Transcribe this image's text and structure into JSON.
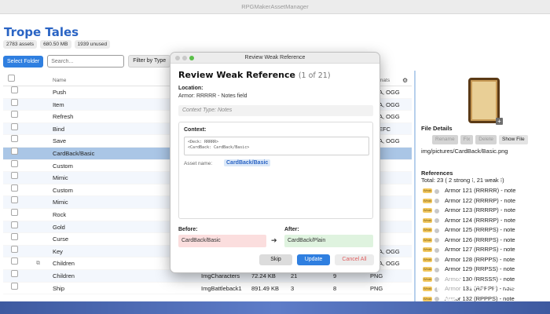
{
  "window": {
    "title": "RPGMakerAssetManager"
  },
  "app": {
    "title": "Trope Tales"
  },
  "stats": [
    "2783 assets",
    "680.50 MB",
    "1939 unused"
  ],
  "toolbar": {
    "select_folder": "Select Folder",
    "search_placeholder": "Search...",
    "filter": "Filter by Type"
  },
  "table": {
    "columns": {
      "name": "Name",
      "formats": "mats"
    },
    "rows": [
      {
        "name": "Push",
        "ext": "A, OGG"
      },
      {
        "name": "Item",
        "ext": "A, OGG"
      },
      {
        "name": "Refresh",
        "ext": "A, OGG"
      },
      {
        "name": "Bind",
        "ext": "EFC"
      },
      {
        "name": "Save",
        "ext": "A, OGG"
      },
      {
        "name": "CardBack/Basic",
        "ext": ""
      },
      {
        "name": "Custom",
        "ext": ""
      },
      {
        "name": "Mimic",
        "ext": ""
      },
      {
        "name": "Custom",
        "ext": ""
      },
      {
        "name": "Mimic",
        "ext": ""
      },
      {
        "name": "Rock",
        "ext": ""
      },
      {
        "name": "Gold",
        "ext": ""
      },
      {
        "name": "Curse",
        "ext": ""
      },
      {
        "name": "Key",
        "ext": "A, OGG"
      },
      {
        "name": "Children",
        "ext": "A, OGG"
      },
      {
        "name": "Children",
        "type": "ImgCharacters",
        "size": "72.24 KB",
        "n1": "21",
        "n2": "9",
        "fmt": "PNG"
      },
      {
        "name": "Ship",
        "type": "ImgBattleback1",
        "size": "891.49 KB",
        "n1": "3",
        "n2": "8",
        "fmt": "PNG"
      }
    ]
  },
  "panel": {
    "file_details": "File Details",
    "buttons": [
      "Rename",
      "Fix",
      "Delete",
      "Show File"
    ],
    "path": "img/pictures/CardBack/Basic.png",
    "references_title": "References",
    "total": "Total: 23 ( 2 strong ⁝, 21 weak ⁝)",
    "tag": "Weak",
    "refs": [
      "Armor 121 (RRRRR) - note",
      "Armor 122 (RRRRP) - note",
      "Armor 123 (RRRRP) - note",
      "Armor 124 (RRRRP) - note",
      "Armor 125 (RRRPS) - note",
      "Armor 126 (RRRPS) - note",
      "Armor 127 (RRRPS) - note",
      "Armor 128 (RRPPS) - note",
      "Armor 129 (RRPSS) - note",
      "Armor 130 (RRSSS) - note",
      "Armor 131 (RPPPP) - note",
      "Armor 132 (RPPPS) - note"
    ]
  },
  "dialog": {
    "window_title": "Review Weak Reference",
    "heading": "Review Weak Reference",
    "counter": "(1 of 21)",
    "location_label": "Location:",
    "location_value": "Armor: RRRRR - Notes field",
    "context_type": "Context Type: Notes",
    "context_label": "Context:",
    "code_line1": "<Deck: RRRRR>",
    "code_line2": "<CardBack: CardBack/Basic>",
    "asset_label": "Asset name:",
    "asset_value": "CardBack/Basic",
    "before_label": "Before:",
    "before_value": "CardBack/Basic",
    "after_label": "After:",
    "after_value": "CardBack/Plain",
    "skip": "Skip",
    "update": "Update",
    "cancel_all": "Cancel All"
  },
  "watermark": "Get Into Pc",
  "colors": {
    "accent": "#2f7fe0",
    "title": "#2a64c4",
    "selected_row": "#aac6e6",
    "before_bg": "#fbdede",
    "after_bg": "#dff3df"
  }
}
